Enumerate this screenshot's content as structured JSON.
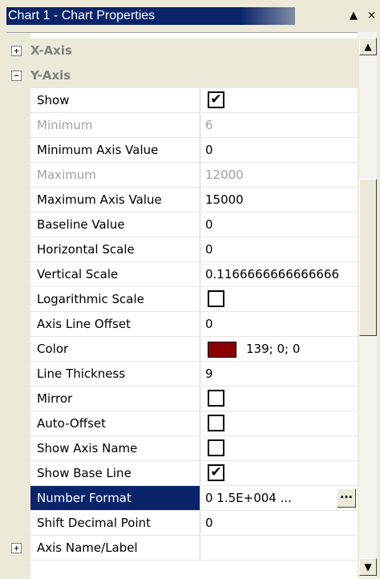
{
  "window": {
    "title": "Chart 1 - Chart Properties",
    "up_arrow": "▲",
    "close_glyph": "×"
  },
  "categories": {
    "x_axis": {
      "label": "X-Axis",
      "expander": "+"
    },
    "y_axis": {
      "label": "Y-Axis",
      "expander": "−"
    },
    "axis_name_label": {
      "label": "Axis Name/Label",
      "expander": "+"
    }
  },
  "properties": {
    "show": {
      "label": "Show",
      "checked": true,
      "check_glyph": "✔"
    },
    "minimum": {
      "label": "Minimum",
      "value": "6"
    },
    "minimum_axis_value": {
      "label": "Minimum Axis Value",
      "value": "0"
    },
    "maximum": {
      "label": "Maximum",
      "value": "12000"
    },
    "maximum_axis_value": {
      "label": "Maximum Axis Value",
      "value": "15000"
    },
    "baseline_value": {
      "label": "Baseline Value",
      "value": "0"
    },
    "horizontal_scale": {
      "label": "Horizontal Scale",
      "value": "0"
    },
    "vertical_scale": {
      "label": "Vertical Scale",
      "value": "0.1166666666666666"
    },
    "logarithmic_scale": {
      "label": "Logarithmic Scale",
      "checked": false
    },
    "axis_line_offset": {
      "label": "Axis Line Offset",
      "value": "0"
    },
    "color": {
      "label": "Color",
      "value": "139; 0; 0",
      "swatch": "#8b0000"
    },
    "line_thickness": {
      "label": "Line Thickness",
      "value": "9"
    },
    "mirror": {
      "label": "Mirror",
      "checked": false
    },
    "auto_offset": {
      "label": "Auto-Offset",
      "checked": false
    },
    "show_axis_name": {
      "label": "Show Axis Name",
      "checked": false
    },
    "show_base_line": {
      "label": "Show Base Line",
      "checked": true,
      "check_glyph": "✔"
    },
    "number_format": {
      "label": "Number Format",
      "value": "0 1.5E+004 ...",
      "button": "..."
    },
    "shift_decimal_point": {
      "label": "Shift Decimal Point",
      "value": "0"
    }
  },
  "scrollbar": {
    "up": "▲",
    "down": "▼"
  },
  "colors": {
    "selection": "#0a246a",
    "panel": "#ece9d8",
    "disabled_text": "#a0a0a0"
  }
}
